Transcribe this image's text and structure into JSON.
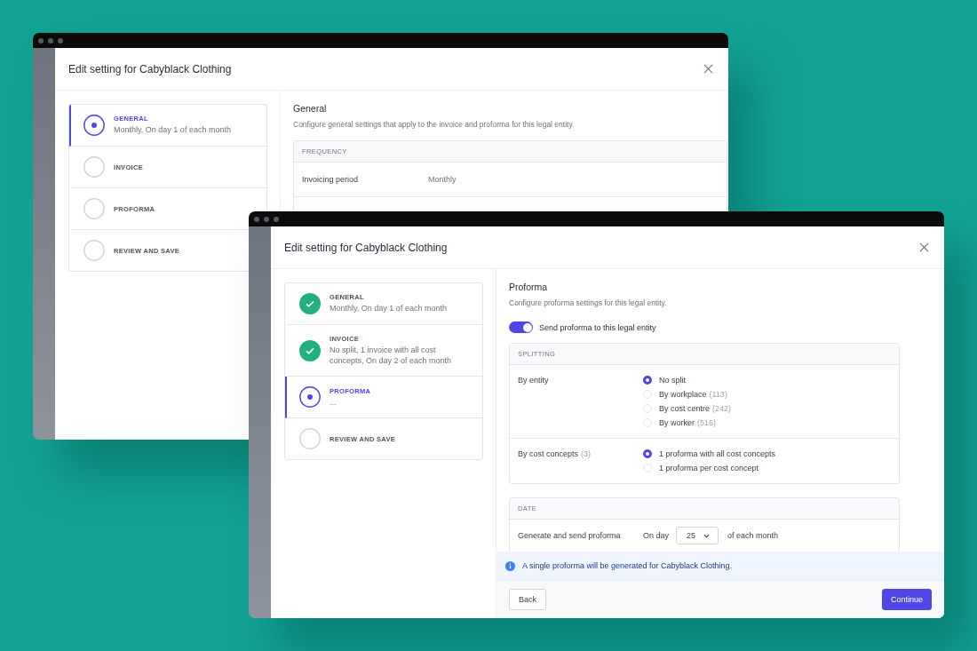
{
  "windows": [
    {
      "title": "Edit setting for Cabyblack Clothing",
      "steps": [
        {
          "label": "GENERAL",
          "summary": "Monthly, On day 1 of each month",
          "kind": "current"
        },
        {
          "label": "INVOICE",
          "kind": "pending"
        },
        {
          "label": "PROFORMA",
          "kind": "pending"
        },
        {
          "label": "REVIEW AND SAVE",
          "kind": "pending"
        }
      ],
      "content": {
        "kind": "general",
        "heading": "General",
        "description": "Configure general settings that apply to the invoice and proforma for this legal entity.",
        "table": {
          "header": "FREQUENCY",
          "rows": [
            {
              "label": "Invoicing period",
              "value": "Monthly"
            }
          ]
        }
      }
    },
    {
      "title": "Edit setting for Cabyblack Clothing",
      "steps": [
        {
          "label": "GENERAL",
          "summary": "Monthly, On day 1 of each month",
          "kind": "done"
        },
        {
          "label": "INVOICE",
          "summary": "No split, 1 invoice with all cost concepts, On day 2 of each month",
          "kind": "done"
        },
        {
          "label": "PROFORMA",
          "summary": "...",
          "kind": "current"
        },
        {
          "label": "REVIEW AND SAVE",
          "kind": "pending"
        }
      ],
      "content": {
        "kind": "proforma",
        "heading": "Proforma",
        "description": "Configure proforma settings for this legal entity.",
        "toggle": {
          "label": "Send proforma to this legal entity",
          "on": true
        },
        "splitting": {
          "header": "SPLITTING",
          "groups": [
            {
              "label": "By entity",
              "options": [
                {
                  "label": "No split",
                  "selected": true
                },
                {
                  "label": "By workplace",
                  "count": "(113)",
                  "selected": false
                },
                {
                  "label": "By cost centre",
                  "count": "(242)",
                  "selected": false
                },
                {
                  "label": "By worker",
                  "count": "(516)",
                  "selected": false
                }
              ]
            },
            {
              "label": "By cost concepts",
              "count": "(3)",
              "options": [
                {
                  "label": "1 proforma with all cost concepts",
                  "selected": true
                },
                {
                  "label": "1 proforma per cost concept",
                  "selected": false
                }
              ]
            }
          ]
        },
        "date": {
          "header": "DATE",
          "label": "Generate and send proforma",
          "prefix": "On day",
          "day": "25",
          "suffix": "of each month"
        },
        "banner": "A single proforma will be generated for Cabyblack Clothing.",
        "buttons": {
          "back": "Back",
          "continue": "Continue"
        }
      }
    }
  ]
}
